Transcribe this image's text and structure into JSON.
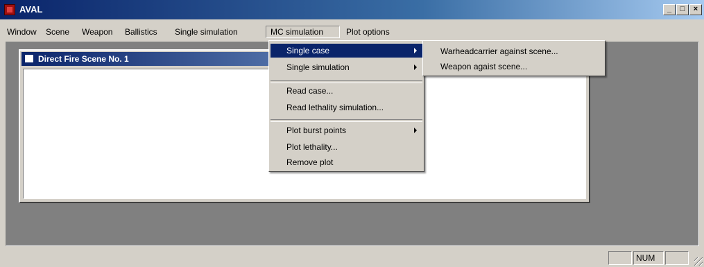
{
  "window": {
    "title": "AVAL",
    "min_label": "_",
    "max_label": "□",
    "close_label": "×"
  },
  "menubar": {
    "items": [
      {
        "label": "Window"
      },
      {
        "label": "Scene"
      },
      {
        "label": "Weapon"
      },
      {
        "label": "Ballistics"
      },
      {
        "label": "Single simulation"
      },
      {
        "label": "MC simulation"
      },
      {
        "label": "Plot options"
      }
    ],
    "active": "MC simulation"
  },
  "child_window": {
    "title": "Direct Fire Scene No. 1"
  },
  "mc_menu": {
    "groups": [
      [
        "Single case",
        "Single simulation"
      ],
      [
        "Read case...",
        "Read lethality simulation..."
      ],
      [
        "Plot burst points",
        "Plot lethality...",
        "Remove plot"
      ]
    ],
    "highlighted": "Single case"
  },
  "submenu": {
    "items": [
      "Warheadcarrier against scene...",
      "Weapon agaist scene..."
    ]
  },
  "statusbar": {
    "num_indicator": "NUM"
  },
  "colors": {
    "titlebar": "#0a246a",
    "face": "#d4d0c8",
    "highlight": "#0a246a",
    "workspace": "#808080"
  }
}
